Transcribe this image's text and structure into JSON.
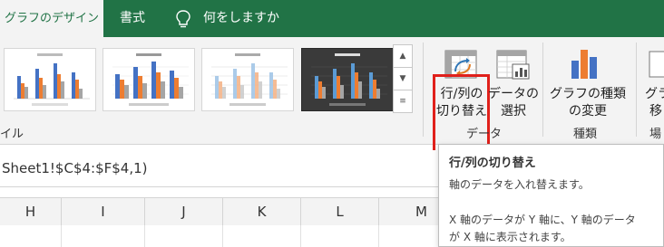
{
  "tabs": {
    "active": "グラフのデザイン",
    "format": "書式",
    "tell_me": "何をしますか"
  },
  "ribbon": {
    "styles_group_label": "イル",
    "switch_row_col_line1": "行/列の",
    "switch_row_col_line2": "切り替え",
    "select_data_line1": "データの",
    "select_data_line2": "選択",
    "data_group_label": "データ",
    "change_type_line1": "グラフの種類",
    "change_type_line2": "の変更",
    "type_group_label": "種類",
    "move_chart_line1": "グラ",
    "move_chart_line2": "移",
    "location_group_label": "場"
  },
  "formula_bar": {
    "text": "Sheet1!$C$4:$F$4,1)"
  },
  "columns": [
    "H",
    "I",
    "J",
    "K",
    "L",
    "M"
  ],
  "tooltip": {
    "title": "行/列の切り替え",
    "line1": "軸のデータを入れ替えます。",
    "line2": "X 軸のデータが Y 軸に、Y 軸のデータ",
    "line3": "が X 軸に表示されます。"
  },
  "colors": {
    "excel_green": "#217346",
    "highlight_red": "#e0201b",
    "series_blue": "#4472c4",
    "series_orange": "#ed7d31",
    "series_gray": "#a5a5a5"
  },
  "icons": [
    "lightbulb-icon",
    "switch-row-column-icon",
    "select-data-icon",
    "change-chart-type-icon",
    "move-chart-icon",
    "gallery-scroll-up-icon",
    "gallery-scroll-down-icon",
    "gallery-more-icon"
  ]
}
